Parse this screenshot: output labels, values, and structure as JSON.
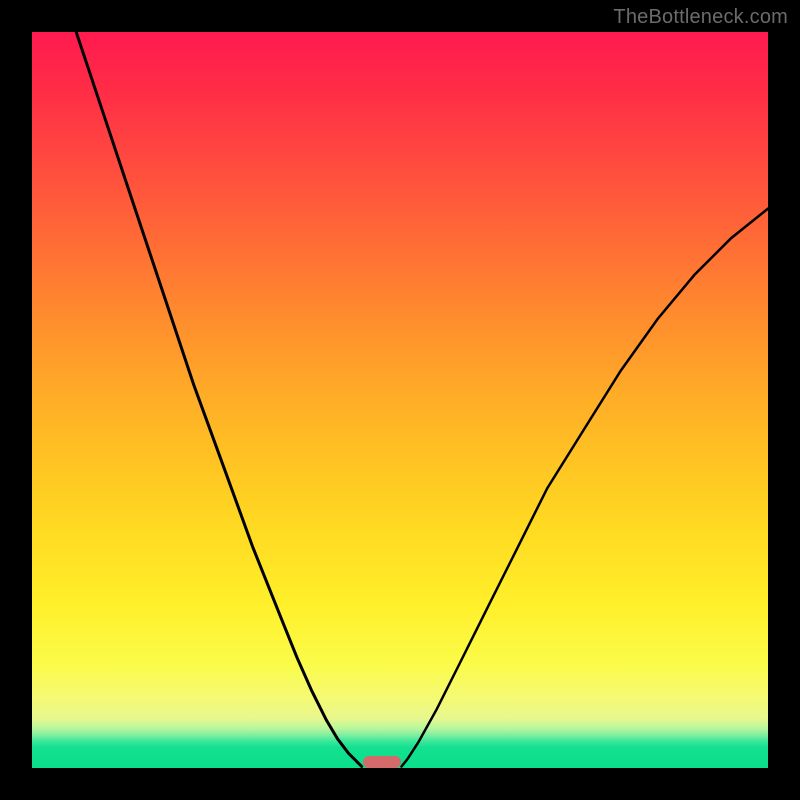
{
  "watermark": "TheBottleneck.com",
  "chart_data": {
    "type": "line",
    "title": "",
    "xlabel": "",
    "ylabel": "",
    "xlim": [
      0,
      100
    ],
    "ylim": [
      0,
      100
    ],
    "grid": false,
    "legend": false,
    "series": [
      {
        "name": "left-curve",
        "x": [
          6,
          10,
          14,
          18,
          22,
          26,
          30,
          34,
          36,
          38,
          40,
          41.5,
          43,
          44,
          44.8
        ],
        "y": [
          100,
          88,
          76,
          64,
          52,
          41,
          30,
          20,
          15,
          10.5,
          6.5,
          4,
          2,
          1,
          0.2
        ]
      },
      {
        "name": "right-curve",
        "x": [
          50.2,
          51,
          52.5,
          55,
          58,
          62,
          66,
          70,
          75,
          80,
          85,
          90,
          95,
          100
        ],
        "y": [
          0.2,
          1.2,
          3.5,
          8,
          14,
          22,
          30,
          38,
          46,
          54,
          61,
          67,
          72,
          76
        ]
      }
    ],
    "indicator": {
      "x_center": 47.6,
      "width_pct": 5.2
    },
    "background_gradient": {
      "top": "#ff1a4f",
      "mid": "#ffd323",
      "floor": "#0adf8c"
    }
  }
}
